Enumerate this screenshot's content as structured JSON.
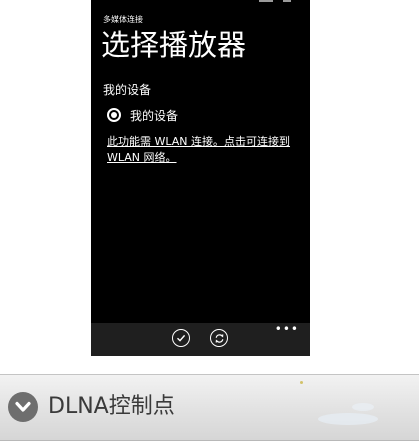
{
  "phone": {
    "app_name": "多媒体连接",
    "title": "选择播放器",
    "section_label": "我的设备",
    "device_option": {
      "label": "我的设备",
      "selected": true
    },
    "wlan_link_text": "此功能需 WLAN 连接。点击可连接到 WLAN 网络。",
    "app_bar": {
      "buttons": [
        "check-icon",
        "refresh-icon"
      ],
      "more_icon": "more-dots-icon"
    }
  },
  "dlna_bar": {
    "icon": "chevron-down-icon",
    "label": "DLNA控制点"
  },
  "colors": {
    "screen_background": "#000000",
    "app_bar_background": "#1f1f1f",
    "text": "#ffffff",
    "dlna_bar_gradient_top": "#f2f2f2",
    "dlna_bar_gradient_bottom": "#d6d6d6",
    "dlna_icon": "#6e6e6e",
    "dlna_text": "#3a3a3a"
  }
}
